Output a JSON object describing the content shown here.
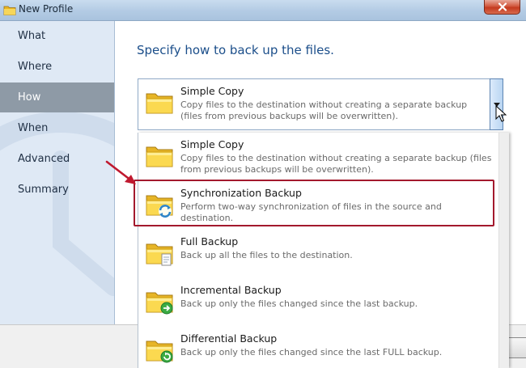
{
  "window": {
    "title": "New Profile",
    "close_icon": "close-icon"
  },
  "sidebar": {
    "items": [
      {
        "label": "What"
      },
      {
        "label": "Where"
      },
      {
        "label": "How"
      },
      {
        "label": "When"
      },
      {
        "label": "Advanced"
      },
      {
        "label": "Summary"
      }
    ],
    "active": "How"
  },
  "main": {
    "heading": "Specify how to back up the files."
  },
  "combo": {
    "selected_title": "Simple Copy",
    "selected_desc": "Copy files to the destination without creating a separate backup (files from previous backups will be overwritten)."
  },
  "dropdown": {
    "options": [
      {
        "title": "Simple Copy",
        "desc": "Copy files to the destination without creating a separate backup (files from previous backups will be overwritten).",
        "icon": "folder-icon"
      },
      {
        "title": "Synchronization Backup",
        "desc": "Perform two-way synchronization of files in the source and destination.",
        "icon": "folder-sync-icon"
      },
      {
        "title": "Full Backup",
        "desc": "Back up all the files to the destination.",
        "icon": "folder-doc-icon"
      },
      {
        "title": "Incremental Backup",
        "desc": "Back up only the files changed since the last backup.",
        "icon": "folder-incremental-icon"
      },
      {
        "title": "Differential Backup",
        "desc": "Back up only the files changed since the last FULL backup.",
        "icon": "folder-differential-icon"
      }
    ]
  },
  "colors": {
    "heading": "#1b4e8a",
    "highlight": "#a3192d",
    "sidebar_active": "#8e9aa6"
  }
}
